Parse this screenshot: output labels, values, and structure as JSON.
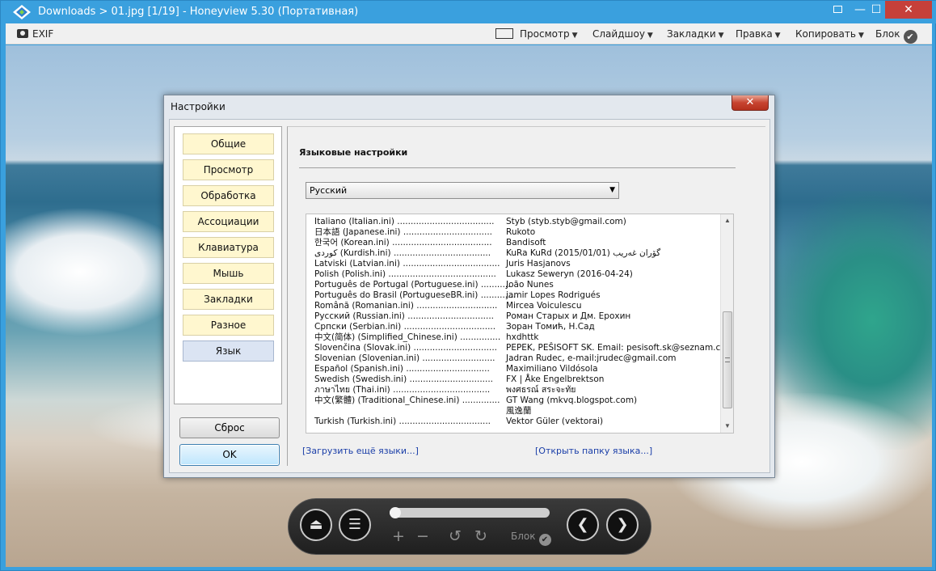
{
  "window": {
    "title": "Downloads > 01.jpg [1/19] - Honeyview 5.30 (Портативная)",
    "fullscreen_icon": "fullscreen-icon",
    "min_label": "—",
    "max_label": "☐",
    "close_label": "✕"
  },
  "toolbar": {
    "exif": "EXIF",
    "view": "Просмотр",
    "slideshow": "Слайдшоу",
    "bookmarks": "Закладки",
    "edit": "Правка",
    "copy": "Копировать",
    "lock": "Блок",
    "arrow": "▼",
    "check": "✔"
  },
  "dialog": {
    "title": "Настройки",
    "close": "✕",
    "nav": [
      {
        "label": "Общие"
      },
      {
        "label": "Просмотр"
      },
      {
        "label": "Обработка"
      },
      {
        "label": "Ассоциации"
      },
      {
        "label": "Клавиатура"
      },
      {
        "label": "Мышь"
      },
      {
        "label": "Закладки"
      },
      {
        "label": "Разное"
      },
      {
        "label": "Язык"
      }
    ],
    "active_nav": "Язык",
    "reset": "Сброс",
    "ok": "OK",
    "section_title": "Языковые настройки",
    "language_selected": "Русский",
    "languages": [
      {
        "name": "Italiano (Italian.ini) ....................................",
        "author": "Styb (styb.styb@gmail.com)"
      },
      {
        "name": "日本語 (Japanese.ini) .................................",
        "author": "Rukoto"
      },
      {
        "name": "한국어 (Korean.ini) .....................................",
        "author": "Bandisoft"
      },
      {
        "name": "كوردی (Kurdish.ini) ....................................",
        "author": "KuRa KuRd (2015/01/01) گۆران غەریب"
      },
      {
        "name": "Latviski (Latvian.ini) ....................................",
        "author": "Juris Hasjanovs"
      },
      {
        "name": "Polish (Polish.ini) ........................................",
        "author": "Lukasz Seweryn (2016-04-24)"
      },
      {
        "name": "Português de Portugal (Portuguese.ini) ...........",
        "author": "João Nunes"
      },
      {
        "name": "Português do Brasil (PortugueseBR.ini) .............",
        "author": "jamir Lopes Rodrigués"
      },
      {
        "name": "Română (Romanian.ini) ..............................",
        "author": "Mircea Voiculescu"
      },
      {
        "name": "Русский (Russian.ini) ................................",
        "author": "Роман Старых и Дм. Ерохин"
      },
      {
        "name": "Српски (Serbian.ini) ..................................",
        "author": "Зоран Томић, Н.Сад"
      },
      {
        "name": "中文(简体) (Simplified_Chinese.ini) ...............",
        "author": "hxdhttk"
      },
      {
        "name": "Slovenčina (Slovak.ini) ...............................",
        "author": "PEPEK, PEŠISOFT SK. Email: pesisoft.sk@seznam.cz"
      },
      {
        "name": "Slovenian (Slovenian.ini) ...........................",
        "author": "Jadran Rudec, e-mail:jrudec@gmail.com"
      },
      {
        "name": "Español (Spanish.ini) ...............................",
        "author": "Maximiliano Vildósola"
      },
      {
        "name": "Swedish (Swedish.ini) ...............................",
        "author": "FX | Åke Engelbrektson"
      },
      {
        "name": "ภาษาไทย (Thai.ini) ....................................",
        "author": "พงศธรณ์ สระจะทัย"
      },
      {
        "name": "中文(繁體) (Traditional_Chinese.ini) ..............",
        "author": "GT Wang (mkvq.blogspot.com)"
      },
      {
        "name": "",
        "author": "風逸蘭"
      },
      {
        "name": "Turkish (Turkish.ini) ..................................",
        "author": "Vektor Güler (vektorai)"
      }
    ],
    "link_more": "[Загрузить ещё языки...]",
    "link_folder": "[Открыть папку языка...]"
  },
  "controls": {
    "eject": "⏏",
    "menu": "☰",
    "zoom_in": "+",
    "zoom_out": "−",
    "rotate_left": "↺",
    "rotate_right": "↻",
    "lock": "Блок",
    "check": "✔",
    "prev": "❮",
    "next": "❯",
    "progress": 0
  }
}
